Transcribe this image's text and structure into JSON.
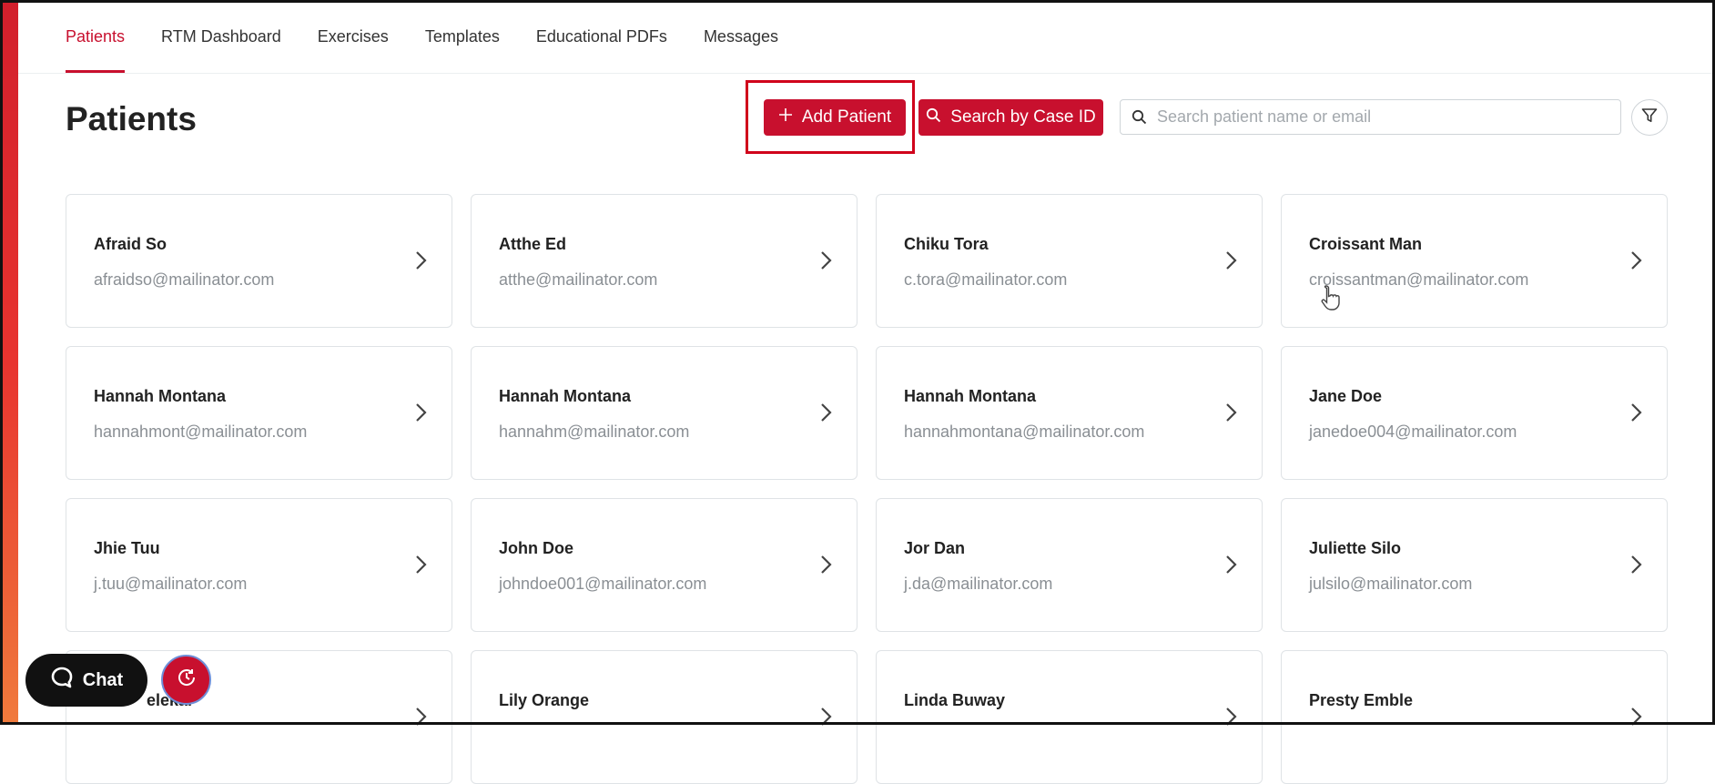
{
  "nav": {
    "tabs": [
      {
        "label": "Patients",
        "active": true
      },
      {
        "label": "RTM Dashboard",
        "active": false
      },
      {
        "label": "Exercises",
        "active": false
      },
      {
        "label": "Templates",
        "active": false
      },
      {
        "label": "Educational PDFs",
        "active": false
      },
      {
        "label": "Messages",
        "active": false
      }
    ]
  },
  "page": {
    "title": "Patients"
  },
  "toolbar": {
    "add_label": "Add Patient",
    "search_case_label": "Search by Case ID",
    "search_placeholder": "Search patient name or email",
    "search_value": ""
  },
  "patients": [
    {
      "name": "Afraid So",
      "email": "afraidso@mailinator.com"
    },
    {
      "name": "Atthe Ed",
      "email": "atthe@mailinator.com"
    },
    {
      "name": "Chiku Tora",
      "email": "c.tora@mailinator.com"
    },
    {
      "name": "Croissant Man",
      "email": "croissantman@mailinator.com"
    },
    {
      "name": "Hannah Montana",
      "email": "hannahmont@mailinator.com"
    },
    {
      "name": "Hannah Montana",
      "email": "hannahm@mailinator.com"
    },
    {
      "name": "Hannah Montana",
      "email": "hannahmontana@mailinator.com"
    },
    {
      "name": "Jane Doe",
      "email": "janedoe004@mailinator.com"
    },
    {
      "name": "Jhie Tuu",
      "email": "j.tuu@mailinator.com"
    },
    {
      "name": "John Doe",
      "email": "johndoe001@mailinator.com"
    },
    {
      "name": "Jor Dan",
      "email": "j.da@mailinator.com"
    },
    {
      "name": "Juliette Silo",
      "email": "julsilo@mailinator.com"
    },
    {
      "name": "elekar",
      "email": ""
    },
    {
      "name": "Lily Orange",
      "email": ""
    },
    {
      "name": "Linda Buway",
      "email": ""
    },
    {
      "name": "Presty Emble",
      "email": ""
    }
  ],
  "widgets": {
    "chat_label": "Chat"
  },
  "colors": {
    "accent": "#c8102e",
    "border": "#dfe3e6",
    "muted_text": "#8a8f94"
  }
}
